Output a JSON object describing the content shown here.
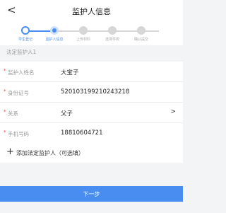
{
  "header": {
    "back_icon": "chevron-left-icon",
    "back_glyph": "<",
    "title": "监护人信息"
  },
  "steps": [
    {
      "label": "学生登记",
      "state": "done"
    },
    {
      "label": "监护人信息",
      "state": "current"
    },
    {
      "label": "上传材料",
      "state": "pending"
    },
    {
      "label": "选择学校",
      "state": "pending"
    },
    {
      "label": "确认提交",
      "state": "pending"
    }
  ],
  "colors": {
    "accent": "#4a8df0",
    "required": "#e0422f",
    "pending": "#d6d6d6"
  },
  "section": {
    "title": "法定监护人1"
  },
  "form": {
    "name": {
      "label": "监护人姓名",
      "value": "大宝子"
    },
    "id_number": {
      "label": "身份证号",
      "value": "520103199210243218"
    },
    "relation": {
      "label": "关系",
      "value": "父子",
      "chevron": ">"
    },
    "phone": {
      "label": "手机号码",
      "value": "18810604721"
    }
  },
  "add_guardian": {
    "icon": "plus-icon",
    "glyph": "+",
    "label": "添加法定监护人（可选填）"
  },
  "footer": {
    "next_label": "下一步"
  }
}
